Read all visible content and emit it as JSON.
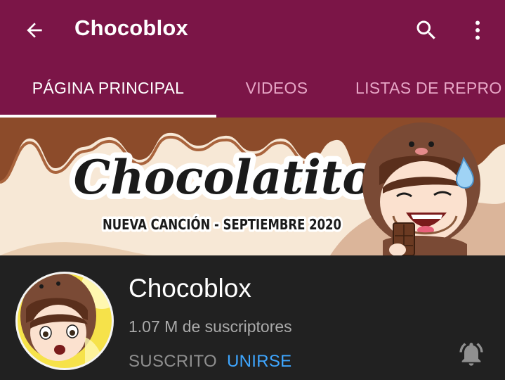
{
  "colors": {
    "appbar": "#7b1547",
    "tab_inactive": "#e7a6c6",
    "background": "#212121",
    "join": "#3ea6ff"
  },
  "header": {
    "back_icon": "arrow-left-icon",
    "title": "Chocoblox",
    "search_icon": "search-icon",
    "more_icon": "more-vertical-icon"
  },
  "tabs": [
    {
      "label": "PÁGINA PRINCIPAL",
      "active": true
    },
    {
      "label": "VIDEOS",
      "active": false
    },
    {
      "label": "LISTAS DE REPRO",
      "active": false
    }
  ],
  "banner": {
    "title": "Chocolatito",
    "subtitle": "NUEVA CANCIÓN - SEPTIEMBRE 2020"
  },
  "channel": {
    "name": "Chocoblox",
    "subscribers": "1.07 M de suscriptores",
    "subscribed_label": "SUSCRITO",
    "join_label": "UNIRSE",
    "bell_icon": "notification-bell-ringing-icon"
  }
}
